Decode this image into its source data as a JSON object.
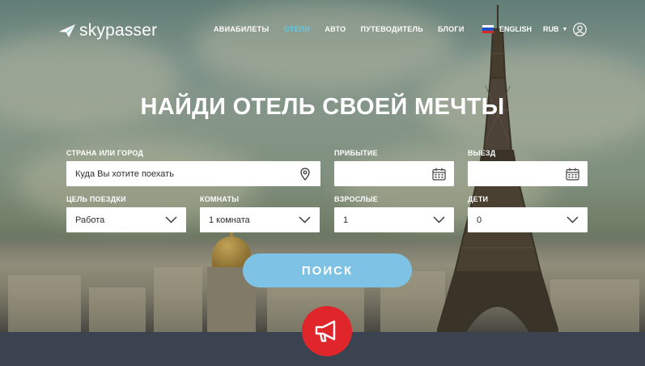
{
  "brand": {
    "name": "skypasser"
  },
  "nav": {
    "items": [
      {
        "label": "АВИАБИЛЕТЫ",
        "active": false
      },
      {
        "label": "ОТЕЛИ",
        "active": true
      },
      {
        "label": "АВТО",
        "active": false
      },
      {
        "label": "ПУТЕВОДИТЕЛЬ",
        "active": false
      },
      {
        "label": "БЛОГИ",
        "active": false
      }
    ],
    "active_color": "#5ec9e8"
  },
  "language": {
    "label": "ENGLISH",
    "flag_icon": "russia-flag-icon"
  },
  "currency": {
    "label": "RUB"
  },
  "hero": {
    "title": "НАЙДИ ОТЕЛЬ СВОЕЙ МЕЧТЫ"
  },
  "form": {
    "destination": {
      "label": "СТРАНА ИЛИ ГОРОД",
      "placeholder": "Куда Вы хотите поехать",
      "icon": "location-pin-icon"
    },
    "arrival": {
      "label": "ПРИБЫТИЕ",
      "value": "",
      "icon": "calendar-icon"
    },
    "departure": {
      "label": "ВЫЕЗД",
      "value": "",
      "icon": "calendar-icon"
    },
    "purpose": {
      "label": "ЦЕЛЬ ПОЕЗДКИ",
      "value": "Работа"
    },
    "rooms": {
      "label": "КОМНАТЫ",
      "value": "1 комната"
    },
    "adults": {
      "label": "ВЗРОСЛЫЕ",
      "value": "1"
    },
    "children": {
      "label": "ДЕТИ",
      "value": "0"
    },
    "submit_label": "ПОИСК"
  },
  "colors": {
    "accent": "#7ec3e6",
    "promo": "#e0262b",
    "footer": "#3b4350"
  }
}
